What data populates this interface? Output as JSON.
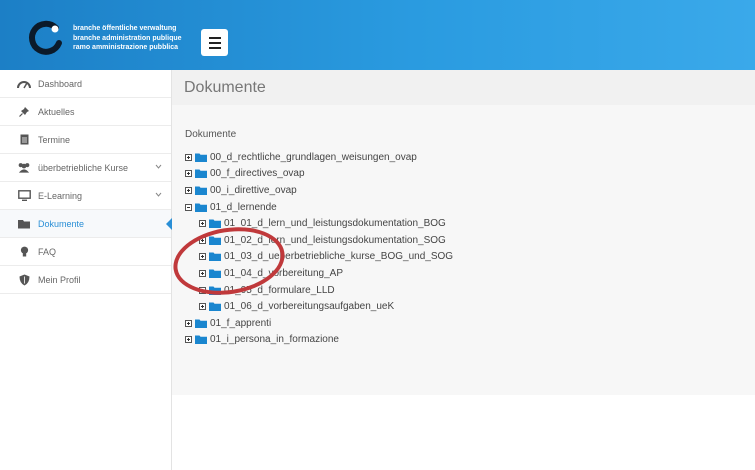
{
  "header": {
    "logo_lines": [
      "branche öffentliche verwaltung",
      "branche administration publique",
      "ramo amministrazione pubblica"
    ]
  },
  "sidebar": {
    "items": [
      {
        "label": "Dashboard",
        "icon": "dashboard-gauge-icon"
      },
      {
        "label": "Aktuelles",
        "icon": "pin-icon"
      },
      {
        "label": "Termine",
        "icon": "calendar-icon"
      },
      {
        "label": "überbetriebliche Kurse",
        "icon": "users-icon",
        "has_submenu": true
      },
      {
        "label": "E-Learning",
        "icon": "monitor-icon",
        "has_submenu": true
      },
      {
        "label": "Dokumente",
        "icon": "folder-open-icon",
        "active": true
      },
      {
        "label": "FAQ",
        "icon": "lightbulb-icon"
      },
      {
        "label": "Mein Profil",
        "icon": "shield-icon"
      }
    ]
  },
  "main": {
    "page_title": "Dokumente",
    "section_label": "Dokumente",
    "tree": [
      {
        "label": "00_d_rechtliche_grundlagen_weisungen_ovap",
        "level": 0,
        "expanded": false
      },
      {
        "label": "00_f_directives_ovap",
        "level": 0,
        "expanded": false
      },
      {
        "label": "00_i_direttive_ovap",
        "level": 0,
        "expanded": false
      },
      {
        "label": "01_d_lernende",
        "level": 0,
        "expanded": true
      },
      {
        "label": "01_01_d_lern_und_leistungsdokumentation_BOG",
        "level": 1,
        "expanded": false
      },
      {
        "label": "01_02_d_lern_und_leistungsdokumentation_SOG",
        "level": 1,
        "expanded": false
      },
      {
        "label": "01_03_d_ueberbetriebliche_kurse_BOG_und_SOG",
        "level": 1,
        "expanded": false
      },
      {
        "label": "01_04_d_vorbereitung_AP",
        "level": 1,
        "expanded": false
      },
      {
        "label": "01_05_d_formulare_LLD",
        "level": 1,
        "expanded": false
      },
      {
        "label": "01_06_d_vorbereitungsaufgaben_ueK",
        "level": 1,
        "expanded": false
      },
      {
        "label": "01_f_apprenti",
        "level": 0,
        "expanded": false
      },
      {
        "label": "01_i_persona_in_formazione",
        "level": 0,
        "expanded": false
      }
    ]
  },
  "colors": {
    "header_start": "#1c7fc6",
    "header_end": "#3aa9ea",
    "accent": "#2a8fd6",
    "folder": "#1a86cf",
    "annotation": "#c0393b"
  }
}
